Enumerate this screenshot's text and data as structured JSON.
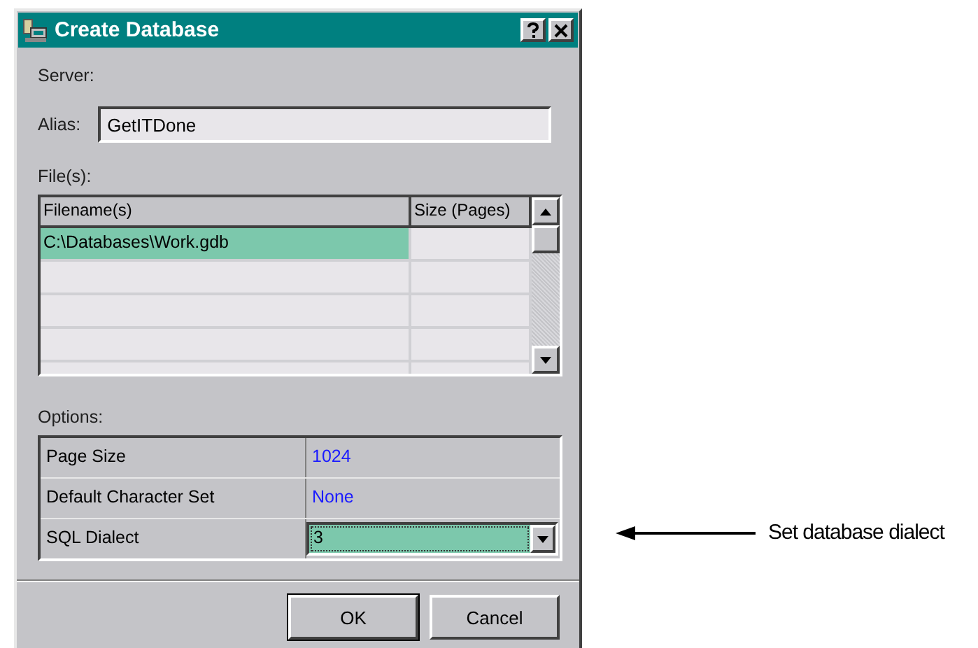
{
  "window": {
    "title": "Create Database"
  },
  "server_label": "Server:",
  "alias": {
    "label": "Alias:",
    "value": "GetITDone"
  },
  "files": {
    "label": "File(s):",
    "columns": [
      "Filename(s)",
      "Size (Pages)"
    ],
    "rows": [
      {
        "filename": "C:\\Databases\\Work.gdb",
        "selected": true
      }
    ]
  },
  "options": {
    "label": "Options:",
    "rows": [
      {
        "name": "Page Size",
        "value": "1024",
        "kind": "text"
      },
      {
        "name": "Default Character Set",
        "value": "None",
        "kind": "text"
      },
      {
        "name": "SQL Dialect",
        "value": "3",
        "kind": "dropdown",
        "selected": true
      }
    ]
  },
  "buttons": [
    "OK",
    "Cancel"
  ],
  "callout": "Set database dialect"
}
